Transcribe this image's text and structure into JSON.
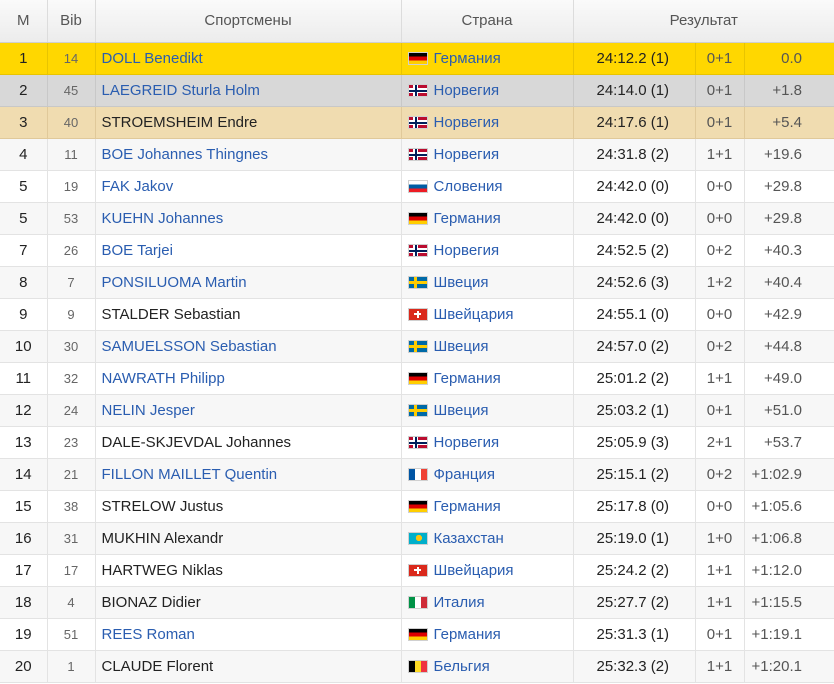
{
  "header": {
    "rank": "М",
    "bib": "Bib",
    "athletes": "Спортсмены",
    "country": "Страна",
    "result": "Результат"
  },
  "rows": [
    {
      "rank": "1",
      "bib": "14",
      "name": "DOLL Benedikt",
      "linked": true,
      "flag": "ger",
      "country": "Германия",
      "time": "24:12.2 (1)",
      "penalties": "0+1",
      "diff": "0.0"
    },
    {
      "rank": "2",
      "bib": "45",
      "name": "LAEGREID Sturla Holm",
      "linked": true,
      "flag": "nor",
      "country": "Норвегия",
      "time": "24:14.0 (1)",
      "penalties": "0+1",
      "diff": "+1.8"
    },
    {
      "rank": "3",
      "bib": "40",
      "name": "STROEMSHEIM Endre",
      "linked": false,
      "flag": "nor",
      "country": "Норвегия",
      "time": "24:17.6 (1)",
      "penalties": "0+1",
      "diff": "+5.4"
    },
    {
      "rank": "4",
      "bib": "11",
      "name": "BOE Johannes Thingnes",
      "linked": true,
      "flag": "nor",
      "country": "Норвегия",
      "time": "24:31.8 (2)",
      "penalties": "1+1",
      "diff": "+19.6"
    },
    {
      "rank": "5",
      "bib": "19",
      "name": "FAK Jakov",
      "linked": true,
      "flag": "svn",
      "country": "Словения",
      "time": "24:42.0 (0)",
      "penalties": "0+0",
      "diff": "+29.8"
    },
    {
      "rank": "5",
      "bib": "53",
      "name": "KUEHN Johannes",
      "linked": true,
      "flag": "ger",
      "country": "Германия",
      "time": "24:42.0 (0)",
      "penalties": "0+0",
      "diff": "+29.8"
    },
    {
      "rank": "7",
      "bib": "26",
      "name": "BOE Tarjei",
      "linked": true,
      "flag": "nor",
      "country": "Норвегия",
      "time": "24:52.5 (2)",
      "penalties": "0+2",
      "diff": "+40.3"
    },
    {
      "rank": "8",
      "bib": "7",
      "name": "PONSILUOMA Martin",
      "linked": true,
      "flag": "swe",
      "country": "Швеция",
      "time": "24:52.6 (3)",
      "penalties": "1+2",
      "diff": "+40.4"
    },
    {
      "rank": "9",
      "bib": "9",
      "name": "STALDER Sebastian",
      "linked": false,
      "flag": "sui",
      "country": "Швейцария",
      "time": "24:55.1 (0)",
      "penalties": "0+0",
      "diff": "+42.9"
    },
    {
      "rank": "10",
      "bib": "30",
      "name": "SAMUELSSON Sebastian",
      "linked": true,
      "flag": "swe",
      "country": "Швеция",
      "time": "24:57.0 (2)",
      "penalties": "0+2",
      "diff": "+44.8"
    },
    {
      "rank": "11",
      "bib": "32",
      "name": "NAWRATH Philipp",
      "linked": true,
      "flag": "ger",
      "country": "Германия",
      "time": "25:01.2 (2)",
      "penalties": "1+1",
      "diff": "+49.0"
    },
    {
      "rank": "12",
      "bib": "24",
      "name": "NELIN Jesper",
      "linked": true,
      "flag": "swe",
      "country": "Швеция",
      "time": "25:03.2 (1)",
      "penalties": "0+1",
      "diff": "+51.0"
    },
    {
      "rank": "13",
      "bib": "23",
      "name": "DALE-SKJEVDAL Johannes",
      "linked": false,
      "flag": "nor",
      "country": "Норвегия",
      "time": "25:05.9 (3)",
      "penalties": "2+1",
      "diff": "+53.7"
    },
    {
      "rank": "14",
      "bib": "21",
      "name": "FILLON MAILLET Quentin",
      "linked": true,
      "flag": "fra",
      "country": "Франция",
      "time": "25:15.1 (2)",
      "penalties": "0+2",
      "diff": "+1:02.9"
    },
    {
      "rank": "15",
      "bib": "38",
      "name": "STRELOW Justus",
      "linked": false,
      "flag": "ger",
      "country": "Германия",
      "time": "25:17.8 (0)",
      "penalties": "0+0",
      "diff": "+1:05.6"
    },
    {
      "rank": "16",
      "bib": "31",
      "name": "MUKHIN Alexandr",
      "linked": false,
      "flag": "kaz",
      "country": "Казахстан",
      "time": "25:19.0 (1)",
      "penalties": "1+0",
      "diff": "+1:06.8"
    },
    {
      "rank": "17",
      "bib": "17",
      "name": "HARTWEG Niklas",
      "linked": false,
      "flag": "sui",
      "country": "Швейцария",
      "time": "25:24.2 (2)",
      "penalties": "1+1",
      "diff": "+1:12.0"
    },
    {
      "rank": "18",
      "bib": "4",
      "name": "BIONAZ Didier",
      "linked": false,
      "flag": "ita",
      "country": "Италия",
      "time": "25:27.7 (2)",
      "penalties": "1+1",
      "diff": "+1:15.5"
    },
    {
      "rank": "19",
      "bib": "51",
      "name": "REES Roman",
      "linked": true,
      "flag": "ger",
      "country": "Германия",
      "time": "25:31.3 (1)",
      "penalties": "0+1",
      "diff": "+1:19.1"
    },
    {
      "rank": "20",
      "bib": "1",
      "name": "CLAUDE Florent",
      "linked": false,
      "flag": "bel",
      "country": "Бельгия",
      "time": "25:32.3 (2)",
      "penalties": "1+1",
      "diff": "+1:20.1"
    }
  ],
  "icons": {
    "ger": "germany-flag-icon",
    "nor": "norway-flag-icon",
    "svn": "slovenia-flag-icon",
    "swe": "sweden-flag-icon",
    "sui": "switzerland-flag-icon",
    "fra": "france-flag-icon",
    "kaz": "kazakhstan-flag-icon",
    "ita": "italy-flag-icon",
    "bel": "belgium-flag-icon"
  },
  "colors": {
    "gold_row": "#ffd700",
    "silver_row": "#d8d8d8",
    "bronze_row": "#f0dcb0",
    "link": "#2a5db0"
  }
}
